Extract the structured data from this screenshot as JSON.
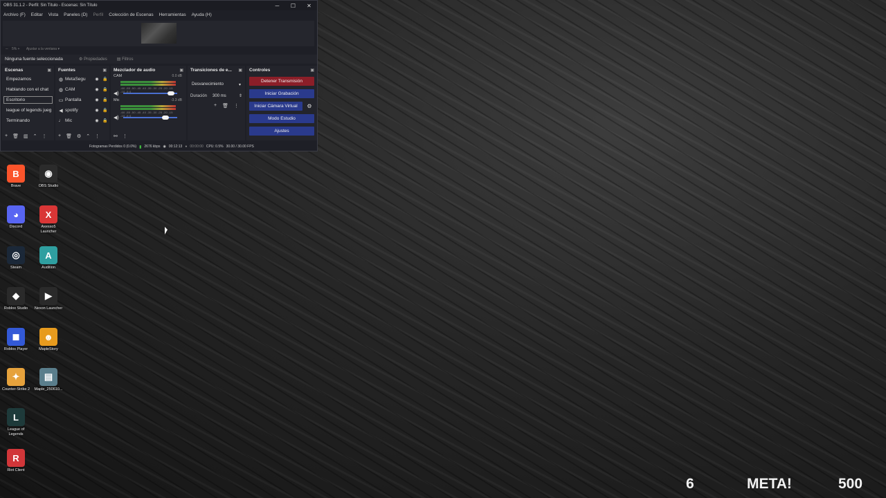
{
  "obs": {
    "title": "OBS 31.1.2 - Perfil: Sin Título - Escenas: Sin Título",
    "window_controls": {
      "minimize": "─",
      "maximize": "☐",
      "close": "✕"
    },
    "menu": [
      "Archivo (F)",
      "Editar",
      "Vista",
      "Paneles (D)",
      "Perfil",
      "Colección de Escenas",
      "Herramientas",
      "Ayuda (H)"
    ],
    "preview_bar": {
      "zoom": "5%",
      "fit": "Ajustar a la ventana"
    },
    "props_bar": {
      "no_source": "Ninguna fuente seleccionada",
      "properties": "Propiedades",
      "filters": "Filtros"
    },
    "scenes": {
      "title": "Escenas",
      "items": [
        "Empezamos",
        "Hablando con el chat",
        "Escritorio",
        "league of legends jueg",
        "Terminando"
      ],
      "selected_index": 2
    },
    "sources": {
      "title": "Fuentes",
      "items": [
        {
          "name": "MetaSegu",
          "icon": "globe-icon"
        },
        {
          "name": "CAM",
          "icon": "camera-icon"
        },
        {
          "name": "Pantalla",
          "icon": "monitor-icon"
        },
        {
          "name": "spotify",
          "icon": "speaker-icon"
        },
        {
          "name": "Mic",
          "icon": "microphone-icon"
        }
      ]
    },
    "mixer": {
      "title": "Mezclador de audio",
      "channels": [
        {
          "name": "CAM",
          "db": "0.0 dB",
          "ticks": "-60 -55 -50 -45 -40 -35 -30 -25 -20 -15 -10 -5 0",
          "volume": 0.88
        },
        {
          "name": "Mic",
          "db": "-3.3 dB",
          "ticks": "-60 -55 -50 -45 -40 -35 -30 -25 -20 -15 -10 -5 0",
          "volume": 0.78
        }
      ]
    },
    "transitions": {
      "title": "Transiciones de e...",
      "selected": "Desvanecimiento",
      "duration_label": "Duración",
      "duration_value": "300 ms"
    },
    "controls": {
      "title": "Controles",
      "stop_stream": "Detener Transmisión",
      "start_recording": "Iniciar Grabación",
      "start_vcam": "Iniciar Cámara Virtual",
      "studio_mode": "Modo Estudio",
      "settings": "Ajustes"
    },
    "status": {
      "dropped": "Fotogramas Perdidos 0 (0.0%)",
      "bitrate": "2676 kbps",
      "stream_time": "00:12:13",
      "rec_time": "00:00:00",
      "cpu": "CPU: 0.5%",
      "fps": "30.00 / 30.00 FPS"
    }
  },
  "desktop_icons": [
    {
      "label": "Brave",
      "icon": "brave-icon",
      "color": "#fb542b",
      "glyph": "B"
    },
    {
      "label": "OBS Studio",
      "icon": "obs-icon",
      "color": "#2b2b2b",
      "glyph": "◉"
    },
    {
      "label": "Discord",
      "icon": "discord-icon",
      "color": "#5865f2",
      "glyph": "◕"
    },
    {
      "label": "Axesso5 Launcher",
      "icon": "axesso-icon",
      "color": "#d93636",
      "glyph": "X"
    },
    {
      "label": "Steam",
      "icon": "steam-icon",
      "color": "#1b2838",
      "glyph": "◎"
    },
    {
      "label": "Audition",
      "icon": "audition-icon",
      "color": "#2f9fa0",
      "glyph": "A"
    },
    {
      "label": "Roblox Studio",
      "icon": "roblox-studio-icon",
      "color": "#2a2a2a",
      "glyph": "◆"
    },
    {
      "label": "Nexon Launcher",
      "icon": "nexon-icon",
      "color": "#2a2a2a",
      "glyph": "▶"
    },
    {
      "label": "Roblox Player",
      "icon": "roblox-player-icon",
      "color": "#3359d6",
      "glyph": "◼"
    },
    {
      "label": "MapleStory",
      "icon": "maplestory-icon",
      "color": "#e79b1e",
      "glyph": "☻"
    },
    {
      "label": "Counter-Strike 2",
      "icon": "cs2-icon",
      "color": "#e6a23c",
      "glyph": "✦"
    },
    {
      "label": "Maple_250610...",
      "icon": "image-file-icon",
      "color": "#5a7e8c",
      "glyph": "▤"
    },
    {
      "label": "League of Legends",
      "icon": "league-icon",
      "color": "#1e3a3a",
      "glyph": "L"
    },
    {
      "label": "Riot Client",
      "icon": "riot-icon",
      "color": "#d13639",
      "glyph": "R"
    }
  ],
  "overlay": {
    "count": "6",
    "label": "META!",
    "goal": "500"
  }
}
